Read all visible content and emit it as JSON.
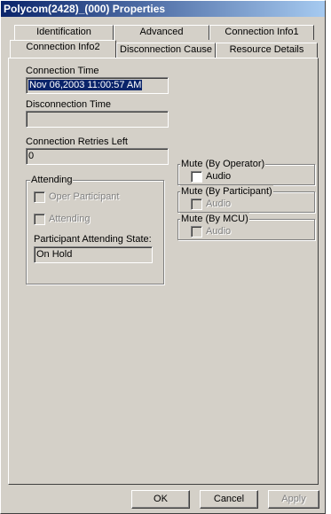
{
  "window": {
    "title": "Polycom(2428)_(000) Properties"
  },
  "tabs": {
    "row1": [
      "Identification",
      "Advanced",
      "Connection Info1"
    ],
    "row2": [
      "Connection Info2",
      "Disconnection Cause",
      "Resource Details"
    ],
    "active": "Connection Info2"
  },
  "connection_time": {
    "label": "Connection Time",
    "value": "Nov 06,2003  11:00:57 AM"
  },
  "disconnection_time": {
    "label": "Disconnection Time",
    "value": ""
  },
  "connection_retries": {
    "label": "Connection Retries Left",
    "value": "0"
  },
  "attending": {
    "title": "Attending",
    "oper_participant": "Oper Participant",
    "attending_label": "Attending",
    "state_label": "Participant Attending State:",
    "state_value": "On Hold"
  },
  "mute_operator": {
    "title": "Mute (By Operator)",
    "audio": "Audio"
  },
  "mute_participant": {
    "title": "Mute (By Participant)",
    "audio": "Audio"
  },
  "mute_mcu": {
    "title": "Mute (By MCU)",
    "audio": "Audio"
  },
  "buttons": {
    "ok": "OK",
    "cancel": "Cancel",
    "apply": "Apply"
  }
}
